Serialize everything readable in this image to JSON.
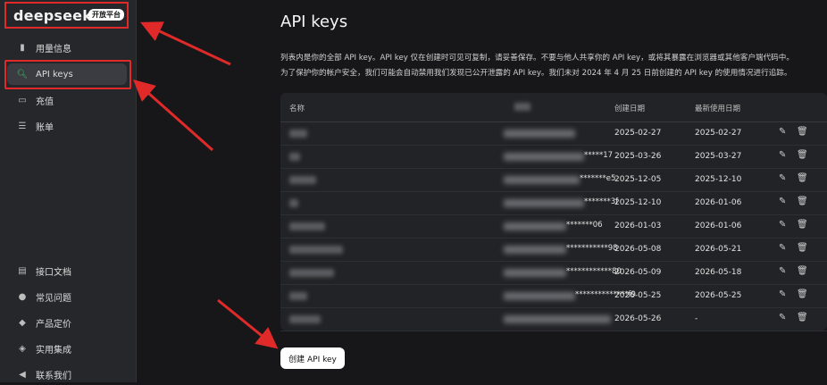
{
  "brand": {
    "logo": "deepseek",
    "badge": "开放平台"
  },
  "nav_top": [
    {
      "label": "用量信息",
      "icon": "bar-chart-icon"
    },
    {
      "label": "API keys",
      "icon": "search-icon",
      "active": true
    },
    {
      "label": "充值",
      "icon": "wallet-icon"
    },
    {
      "label": "账单",
      "icon": "receipt-icon"
    }
  ],
  "nav_bottom": [
    {
      "label": "接口文档",
      "icon": "doc-icon"
    },
    {
      "label": "常见问题",
      "icon": "question-icon"
    },
    {
      "label": "产品定价",
      "icon": "tag-icon"
    },
    {
      "label": "实用集成",
      "icon": "layers-icon"
    },
    {
      "label": "联系我们",
      "icon": "send-icon"
    }
  ],
  "page": {
    "title": "API keys",
    "description_line1": "列表内是你的全部 API key。API key 仅在创建时可见可复制，请妥善保存。不要与他人共享你的 API key，或将其暴露在浏览器或其他客户端代码中。",
    "description_line2": "为了保护你的帐户安全，我们可能会自动禁用我们发现已公开泄露的 API key。我们未对 2024 年 4 月 25 日前创建的 API key 的使用情况进行追踪。"
  },
  "table": {
    "headers": {
      "name": "名称",
      "created": "创建日期",
      "last_used": "最新使用日期"
    },
    "rows": [
      {
        "key_suffix": "",
        "created": "2025-02-27",
        "last_used": "2025-02-27"
      },
      {
        "key_suffix": "*****17",
        "created": "2025-03-26",
        "last_used": "2025-03-27"
      },
      {
        "key_suffix": "*******e5",
        "created": "2025-12-05",
        "last_used": "2025-12-10"
      },
      {
        "key_suffix": "*******3f",
        "created": "2025-12-10",
        "last_used": "2026-01-06"
      },
      {
        "key_suffix": "*******06",
        "created": "2026-01-03",
        "last_used": "2026-01-06"
      },
      {
        "key_suffix": "***********98",
        "created": "2026-05-08",
        "last_used": "2026-05-21"
      },
      {
        "key_suffix": "************80",
        "created": "2026-05-09",
        "last_used": "2026-05-18"
      },
      {
        "key_suffix": "**************f9",
        "created": "2026-05-25",
        "last_used": "2026-05-25"
      },
      {
        "key_suffix": "",
        "created": "2026-05-26",
        "last_used": "-"
      }
    ]
  },
  "actions": {
    "create_label": "创建 API key"
  },
  "colors": {
    "accent": "#e02a2a",
    "active_icon": "#39c160"
  }
}
